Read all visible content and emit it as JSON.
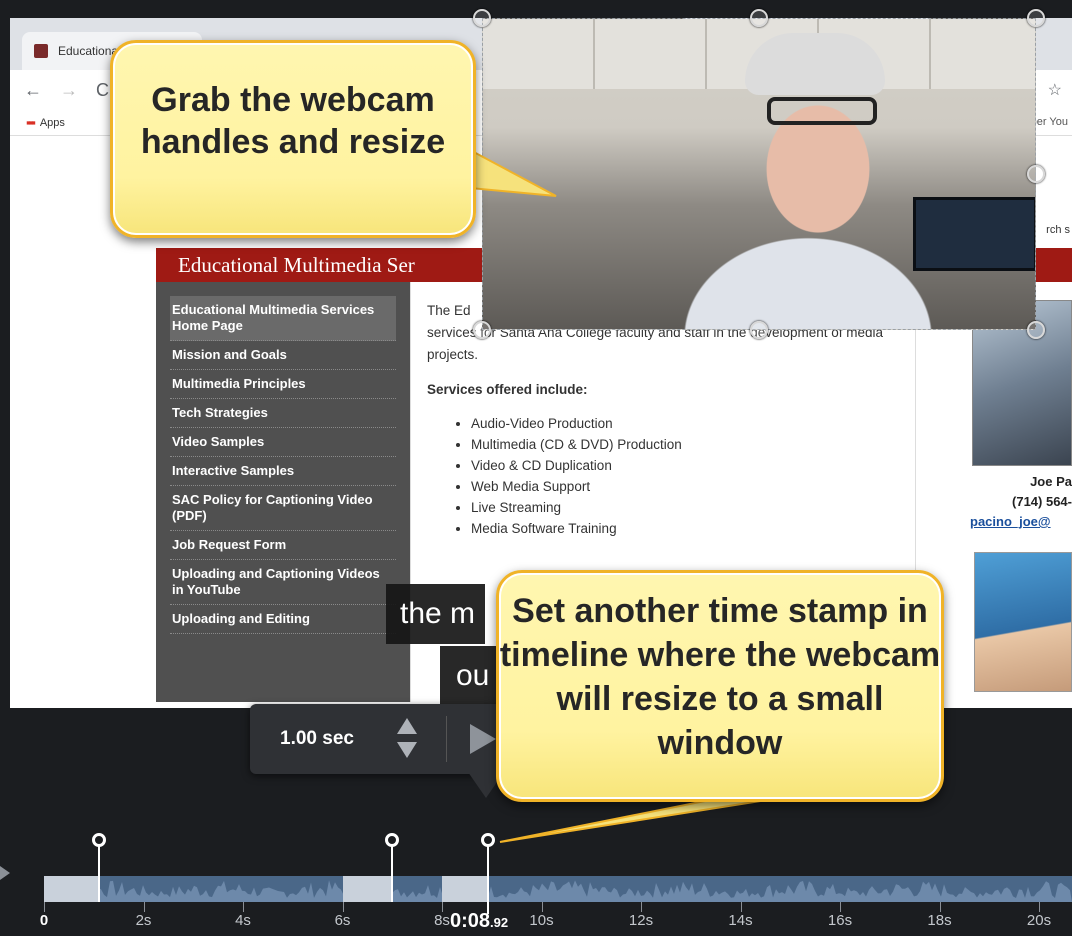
{
  "browser": {
    "tab_title": "Educational",
    "bookmarks_label": "Apps",
    "bookmarks_right": "per You",
    "search_fragment": "rch s"
  },
  "website": {
    "banner": "Educational Multimedia Ser",
    "nav_items": [
      "Educational Multimedia Services Home Page",
      "Mission and Goals",
      "Multimedia Principles",
      "Tech Strategies",
      "Video Samples",
      "Interactive Samples",
      "SAC Policy for Captioning Video (PDF)",
      "Job Request Form",
      "Uploading and Captioning Videos in YouTube",
      "Uploading and Editing"
    ],
    "intro_fragment": "The Ed",
    "intro_rest": "services for Santa Ana College faculty and staff in the development of media projects.",
    "services_heading": "Services offered include:",
    "services": [
      "Audio-Video Production",
      "Multimedia (CD & DVD) Production",
      "Video & CD Duplication",
      "Web Media Support",
      "Live Streaming",
      "Media Software Training"
    ],
    "contact_name": "Joe Pa",
    "contact_phone": "(714) 564-",
    "contact_email": "pacino_joe@"
  },
  "caption": {
    "line1": "the m",
    "line2": "ou"
  },
  "callouts": {
    "resize_tip": "Grab the webcam handles and resize",
    "timestamp_tip": "Set another time stamp in timeline where the webcam will resize to a small window"
  },
  "duration_panel": {
    "value": "1.00 sec"
  },
  "timeline": {
    "current_time": "0:08",
    "current_time_fraction": ".92",
    "tick_labels": [
      "0",
      "2s",
      "4s",
      "6s",
      "8s",
      "10s",
      "12s",
      "14s",
      "16s",
      "18s",
      "20s"
    ],
    "ticks_seconds": [
      0,
      2,
      4,
      6,
      8,
      10,
      12,
      14,
      16,
      18,
      20
    ],
    "markers_seconds": [
      1.1,
      7.0,
      8.92
    ],
    "highlight_segments_seconds": [
      [
        0,
        1.1
      ],
      [
        6.0,
        7.0
      ],
      [
        8.0,
        8.92
      ]
    ],
    "playhead_seconds": 8.92
  },
  "colors": {
    "callout_fill": "#fff3a0",
    "callout_border": "#f0b328",
    "banner": "#9f1a14",
    "track": "#4a6788",
    "highlight": "#c9d1db"
  }
}
